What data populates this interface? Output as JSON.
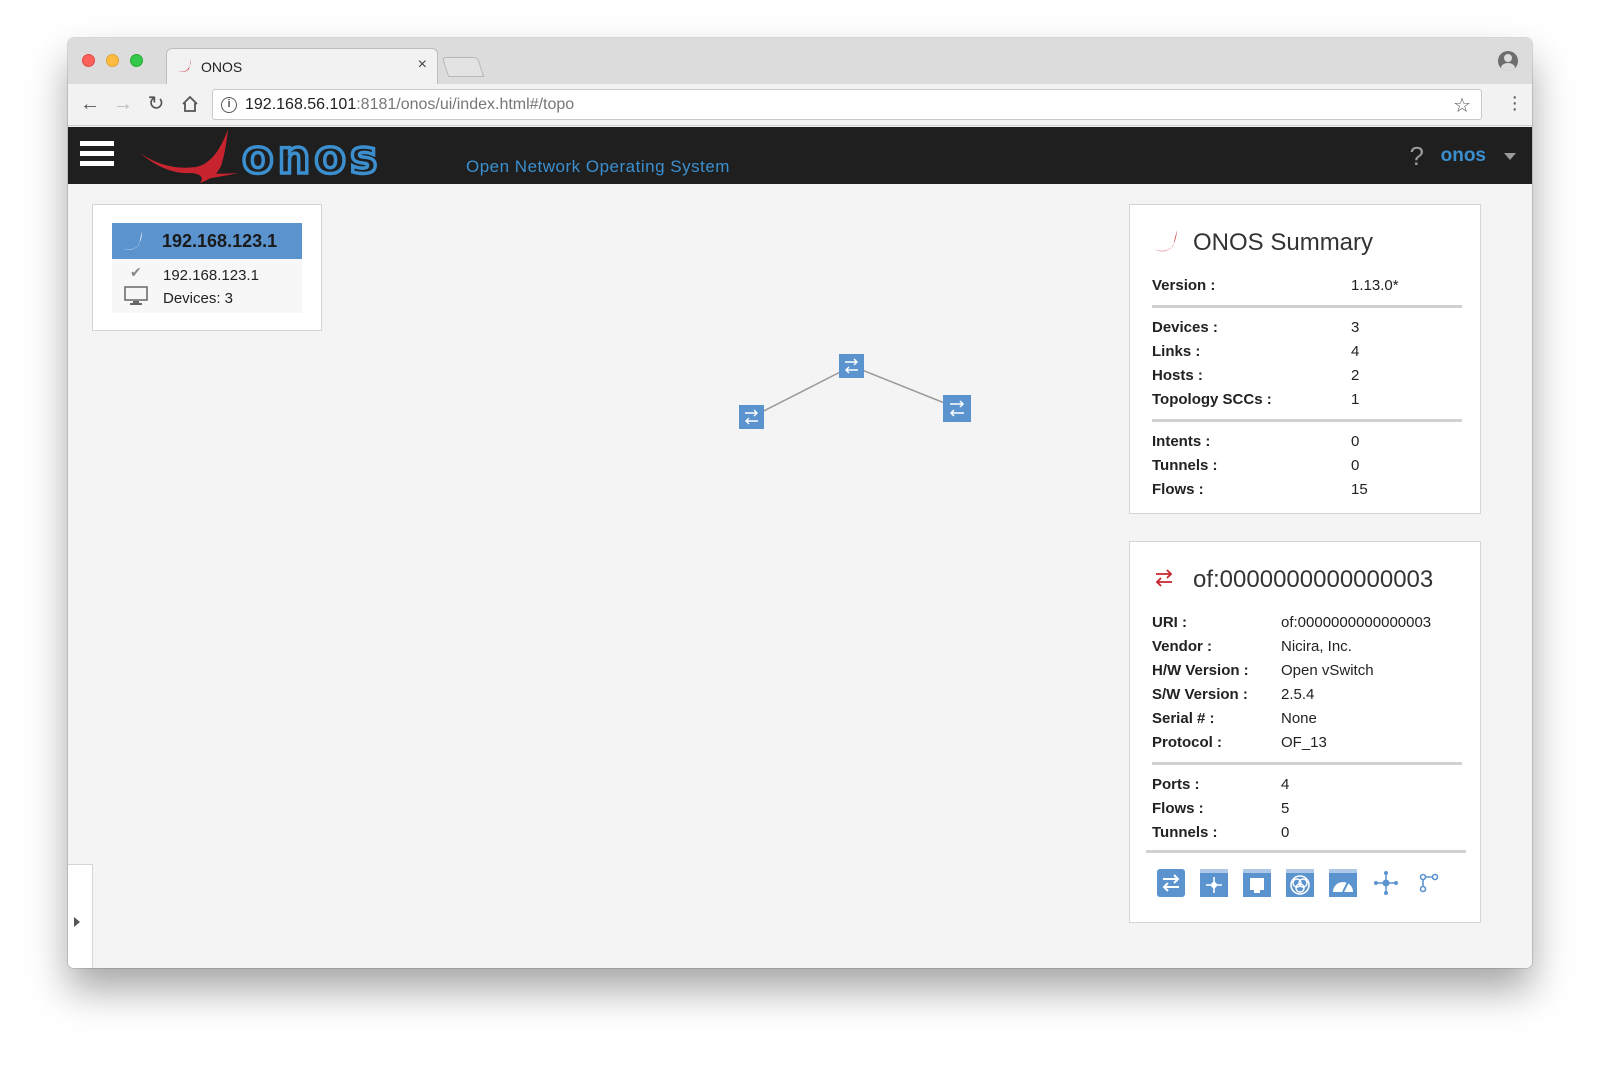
{
  "browser": {
    "tab_title": "ONOS",
    "tab_close": "×",
    "url_host": "192.168.56.101",
    "url_rest": ":8181/onos/ui/index.html#/topo"
  },
  "masthead": {
    "logo_text": "onos",
    "tagline": "Open Network Operating System",
    "help": "?",
    "user": "onos"
  },
  "cluster": {
    "title": "192.168.123.1",
    "node_ip": "192.168.123.1",
    "devices": "Devices: 3"
  },
  "topology": {
    "nodes": [
      "device-1",
      "device-2",
      "device-3"
    ],
    "links": 2
  },
  "summary": {
    "title": "ONOS Summary",
    "version_label": "Version :",
    "version": "1.13.0*",
    "devices_label": "Devices :",
    "devices": "3",
    "links_label": "Links :",
    "links": "4",
    "hosts_label": "Hosts :",
    "hosts": "2",
    "sccs_label": "Topology SCCs :",
    "sccs": "1",
    "intents_label": "Intents :",
    "intents": "0",
    "tunnels_label": "Tunnels :",
    "tunnels": "0",
    "flows_label": "Flows :",
    "flows": "15"
  },
  "device": {
    "title": "of:0000000000000003",
    "uri_label": "URI :",
    "uri": "of:0000000000000003",
    "vendor_label": "Vendor :",
    "vendor": "Nicira, Inc.",
    "hw_label": "H/W Version :",
    "hw": "Open vSwitch",
    "sw_label": "S/W Version :",
    "sw": "2.5.4",
    "serial_label": "Serial # :",
    "serial": "None",
    "protocol_label": "Protocol :",
    "protocol": "OF_13",
    "ports_label": "Ports :",
    "ports": "4",
    "flows_label": "Flows :",
    "flows": "5",
    "tunnels_label": "Tunnels :",
    "tunnels": "0",
    "buttons": [
      "device-table-icon",
      "flow-table-icon",
      "port-table-icon",
      "group-table-icon",
      "meter-table-icon",
      "pipeconf-icon",
      "related-paths-icon"
    ]
  },
  "colors": {
    "accent_blue": "#3b8fcf",
    "node_blue": "#5b93cf",
    "brand_red": "#c8242f",
    "masthead_bg": "#1f1f1f"
  }
}
